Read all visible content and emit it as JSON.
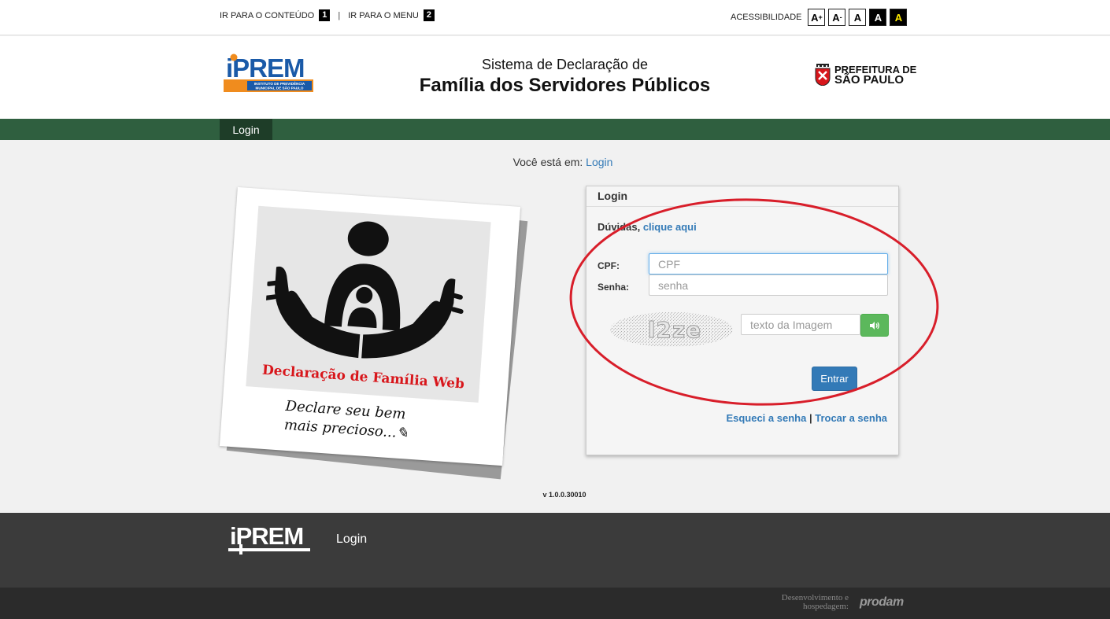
{
  "topbar": {
    "skip_content": "IR PARA O CONTEÚDO",
    "skip_content_key": "1",
    "separator": "|",
    "skip_menu": "IR PARA O MENU",
    "skip_menu_key": "2",
    "accessibility_label": "ACESSIBILIDADE",
    "buttons": [
      "A+",
      "A-",
      "A",
      "A",
      "A"
    ]
  },
  "header": {
    "logo_text": "iPREM",
    "logo_subtext": "INSTITUTO DE PREVIDÊNCIA MUNICIPAL DE SÃO PAULO",
    "title_line1": "Sistema de Declaração de",
    "title_line2": "Família dos Servidores Públicos",
    "prefeitura_line1": "PREFEITURA DE",
    "prefeitura_line2": "SÃO PAULO"
  },
  "nav": {
    "active_tab": "Login"
  },
  "breadcrumb": {
    "prefix": "Você está em:",
    "link": "Login"
  },
  "polaroid": {
    "title": "Declaração de Família Web",
    "caption_line1": "Declare seu bem",
    "caption_line2": "mais precioso...✎"
  },
  "login": {
    "header": "Login",
    "help_prefix": "Dúvidas,",
    "help_link": "clique aqui",
    "cpf_label": "CPF:",
    "cpf_placeholder": "CPF",
    "senha_label": "Senha:",
    "senha_placeholder": "senha",
    "captcha_text": "l2ze",
    "captcha_placeholder": "texto da Imagem",
    "submit_label": "Entrar",
    "forgot_link": "Esqueci a senha",
    "links_sep": "|",
    "change_link": "Trocar a senha"
  },
  "version": "v 1.0.0.30010",
  "footer": {
    "logo_text": "iPREM",
    "link": "Login",
    "dev_label": "Desenvolvimento e hospedagem:",
    "dev_brand": "prodam"
  },
  "colors": {
    "nav_green": "#2f5f3f",
    "nav_active": "#1e3d28",
    "link_blue": "#337ab7",
    "button_blue": "#337ab7",
    "audio_green": "#5cb85c",
    "annotation_red": "#d81e2a",
    "iprem_blue": "#1a5aa8",
    "iprem_orange": "#f08c1e"
  }
}
